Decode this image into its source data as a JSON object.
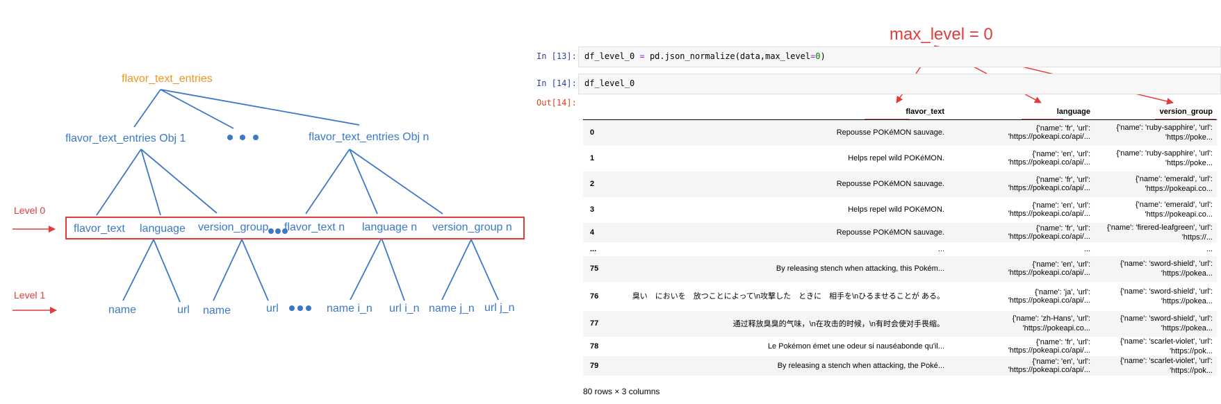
{
  "diagram": {
    "root": "flavor_text_entries",
    "objects": [
      "flavor_text_entries Obj 1",
      "flavor_text_entries Obj n"
    ],
    "level0_label": "Level 0",
    "level1_label": "Level 1",
    "level0_keys": [
      "flavor_text",
      "language",
      "version_group",
      "flavor_text n",
      "language n",
      "version_group n"
    ],
    "level1_keys": [
      "name",
      "url",
      "name",
      "url",
      "name i_n",
      "url i_n",
      "name j_n",
      "url j_n"
    ],
    "colors": {
      "tree": "#3b78c8",
      "root": "#f0961e",
      "highlight": "#e23b3b"
    }
  },
  "notebook": {
    "annotation": "max_level = 0",
    "cell13": {
      "prompt": "In [13]:",
      "code_parts": [
        "df_level_0 ",
        "=",
        " pd.json_normalize(data,max_level",
        "=",
        "0",
        ")"
      ]
    },
    "cell14": {
      "prompt": "In [14]:",
      "code": "df_level_0"
    },
    "out_prompt": "Out[14]:",
    "columns": [
      "flavor_text",
      "language",
      "version_group"
    ],
    "rows": [
      [
        "0",
        "Repousse POKéMON sauvage.",
        "{'name': 'fr', 'url': 'https://pokeapi.co/api/...",
        "{'name': 'ruby-sapphire', 'url': 'https://poke..."
      ],
      [
        "1",
        "Helps repel wild POKéMON.",
        "{'name': 'en', 'url': 'https://pokeapi.co/api/...",
        "{'name': 'ruby-sapphire', 'url': 'https://poke..."
      ],
      [
        "2",
        "Repousse POKéMON sauvage.",
        "{'name': 'fr', 'url': 'https://pokeapi.co/api/...",
        "{'name': 'emerald', 'url': 'https://pokeapi.co..."
      ],
      [
        "3",
        "Helps repel wild POKéMON.",
        "{'name': 'en', 'url': 'https://pokeapi.co/api/...",
        "{'name': 'emerald', 'url': 'https://pokeapi.co..."
      ],
      [
        "4",
        "Repousse POKéMON sauvage.",
        "{'name': 'fr', 'url': 'https://pokeapi.co/api/...",
        "{'name': 'firered-leafgreen', 'url': 'https://..."
      ],
      [
        "...",
        "...",
        "...",
        "..."
      ],
      [
        "75",
        "By releasing stench when attacking, this Pokém...",
        "{'name': 'en', 'url': 'https://pokeapi.co/api/...",
        "{'name': 'sword-shield', 'url': 'https://pokea..."
      ],
      [
        "76",
        "臭い　においを　放つことによって\\n攻撃した　ときに　相手を\\nひるませることが ある。",
        "{'name': 'ja', 'url': 'https://pokeapi.co/api/...",
        "{'name': 'sword-shield', 'url': 'https://pokea..."
      ],
      [
        "77",
        "通过释放臭臭的气味，\\n在攻击的时候，\\n有时会使对手畏缩。",
        "{'name': 'zh-Hans', 'url': 'https://pokeapi.co...",
        "{'name': 'sword-shield', 'url': 'https://pokea..."
      ],
      [
        "78",
        "Le Pokémon émet une odeur si nauséabonde qu'il...",
        "{'name': 'fr', 'url': 'https://pokeapi.co/api/...",
        "{'name': 'scarlet-violet', 'url': 'https://pok..."
      ],
      [
        "79",
        "By releasing a stench when attacking, the Poké...",
        "{'name': 'en', 'url': 'https://pokeapi.co/api/...",
        "{'name': 'scarlet-violet', 'url': 'https://pok..."
      ]
    ],
    "row_count": "80 rows × 3 columns"
  }
}
